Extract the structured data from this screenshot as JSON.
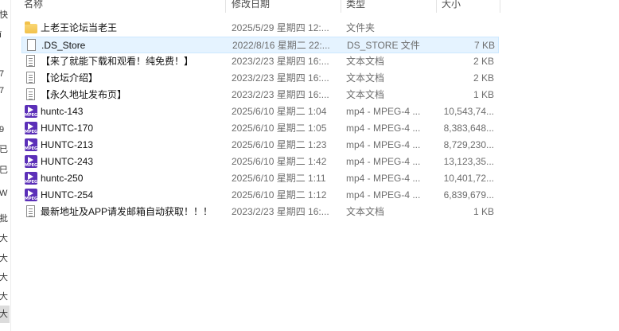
{
  "nav_strip": [
    "快",
    "ī",
    "7",
    "7",
    "9",
    "已",
    "巳",
    "W",
    "批",
    "大",
    "大",
    "大",
    "大",
    "大"
  ],
  "columns": {
    "name": "名称",
    "date": "修改日期",
    "type": "类型",
    "size": "大小"
  },
  "files": [
    {
      "name": "上老王论坛当老王",
      "date": "2025/5/29 星期四 12:...",
      "type": "文件夹",
      "size": "",
      "icon": "folder-icon"
    },
    {
      "name": ".DS_Store",
      "date": "2022/8/16 星期二 22:...",
      "type": "DS_STORE 文件",
      "size": "7 KB",
      "icon": "file-icon",
      "selected": true
    },
    {
      "name": "【来了就能下载和观看！纯免费！】",
      "date": "2023/2/23 星期四 16:...",
      "type": "文本文档",
      "size": "2 KB",
      "icon": "text-file-icon"
    },
    {
      "name": "【论坛介绍】",
      "date": "2023/2/23 星期四 16:...",
      "type": "文本文档",
      "size": "2 KB",
      "icon": "text-file-icon"
    },
    {
      "name": "【永久地址发布页】",
      "date": "2023/2/23 星期四 16:...",
      "type": "文本文档",
      "size": "1 KB",
      "icon": "text-file-icon"
    },
    {
      "name": "huntc-143",
      "date": "2025/6/10 星期二 1:04",
      "type": "mp4 - MPEG-4 ...",
      "size": "10,543,74...",
      "icon": "mp4-icon"
    },
    {
      "name": "HUNTC-170",
      "date": "2025/6/10 星期二 1:05",
      "type": "mp4 - MPEG-4 ...",
      "size": "8,383,648...",
      "icon": "mp4-icon"
    },
    {
      "name": "HUNTC-213",
      "date": "2025/6/10 星期二 1:23",
      "type": "mp4 - MPEG-4 ...",
      "size": "8,729,230...",
      "icon": "mp4-icon"
    },
    {
      "name": "HUNTC-243",
      "date": "2025/6/10 星期二 1:42",
      "type": "mp4 - MPEG-4 ...",
      "size": "13,123,35...",
      "icon": "mp4-icon"
    },
    {
      "name": "huntc-250",
      "date": "2025/6/10 星期二 1:11",
      "type": "mp4 - MPEG-4 ...",
      "size": "10,401,72...",
      "icon": "mp4-icon"
    },
    {
      "name": "HUNTC-254",
      "date": "2025/6/10 星期二 1:12",
      "type": "mp4 - MPEG-4 ...",
      "size": "6,839,679...",
      "icon": "mp4-icon"
    },
    {
      "name": "最新地址及APP请发邮箱自动获取！！！",
      "date": "2023/2/23 星期四 16:...",
      "type": "文本文档",
      "size": "1 KB",
      "icon": "text-file-icon"
    }
  ],
  "mp4_badge": "MPEG"
}
